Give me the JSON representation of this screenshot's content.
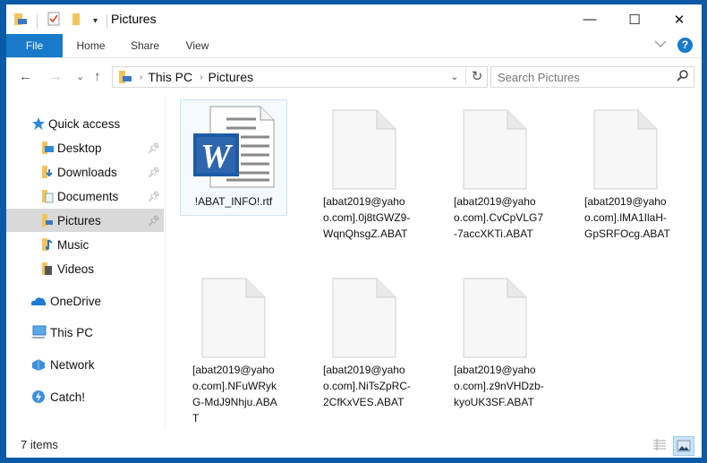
{
  "window": {
    "title": "Pictures",
    "controls": {
      "minimize": "—",
      "maximize": "☐",
      "close": "✕"
    }
  },
  "ribbon": {
    "tabs": [
      {
        "label": "File",
        "active": true
      },
      {
        "label": "Home"
      },
      {
        "label": "Share"
      },
      {
        "label": "View"
      }
    ],
    "expand_icon": "chevron-down-icon",
    "help_label": "?"
  },
  "nav": {
    "back": "←",
    "forward": "→",
    "recent": "⌄",
    "up": "↑",
    "breadcrumb": [
      "This PC",
      "Pictures"
    ],
    "separator": "›",
    "refresh": "↻",
    "dropdown": "⌄"
  },
  "search": {
    "placeholder": "Search Pictures",
    "icon": "⚲"
  },
  "sidebar": {
    "items": [
      {
        "label": "Quick access",
        "icon": "star-icon",
        "level": 0
      },
      {
        "label": "Desktop",
        "icon": "desktop-folder-icon",
        "level": 1,
        "pinned": true
      },
      {
        "label": "Downloads",
        "icon": "downloads-folder-icon",
        "level": 1,
        "pinned": true
      },
      {
        "label": "Documents",
        "icon": "documents-folder-icon",
        "level": 1,
        "pinned": true
      },
      {
        "label": "Pictures",
        "icon": "pictures-folder-icon",
        "level": 1,
        "pinned": true,
        "selected": true
      },
      {
        "label": "Music",
        "icon": "music-folder-icon",
        "level": 1
      },
      {
        "label": "Videos",
        "icon": "videos-folder-icon",
        "level": 1
      },
      {
        "label": "OneDrive",
        "icon": "onedrive-icon",
        "level": 0
      },
      {
        "label": "This PC",
        "icon": "computer-icon",
        "level": 0
      },
      {
        "label": "Network",
        "icon": "network-icon",
        "level": 0
      },
      {
        "label": "Catch!",
        "icon": "catch-icon",
        "level": 0
      }
    ]
  },
  "files": [
    {
      "name": "!ABAT_INFO!.rtf",
      "type": "word-document",
      "selected": true
    },
    {
      "name": "[abat2019@yahoo.com].0j8tGWZ9-WqnQhsgZ.ABAT",
      "type": "blank"
    },
    {
      "name": "[abat2019@yahoo.com].CvCpVLG7-7accXKTi.ABAT",
      "type": "blank"
    },
    {
      "name": "[abat2019@yahoo.com].lMA1IlaH-GpSRFOcg.ABAT",
      "type": "blank"
    },
    {
      "name": "[abat2019@yahoo.com].NFuWRykG-MdJ9Nhju.ABAT",
      "type": "blank"
    },
    {
      "name": "[abat2019@yahoo.com].NiTsZpRC-2CfKxVES.ABAT",
      "type": "blank"
    },
    {
      "name": "[abat2019@yahoo.com].z9nVHDzb-kyoUK3SF.ABAT",
      "type": "blank"
    }
  ],
  "status": {
    "item_count": "7 items"
  },
  "colors": {
    "accent": "#1979ca",
    "frame": "#0b5aa8",
    "selection": "#d9d9d9"
  }
}
